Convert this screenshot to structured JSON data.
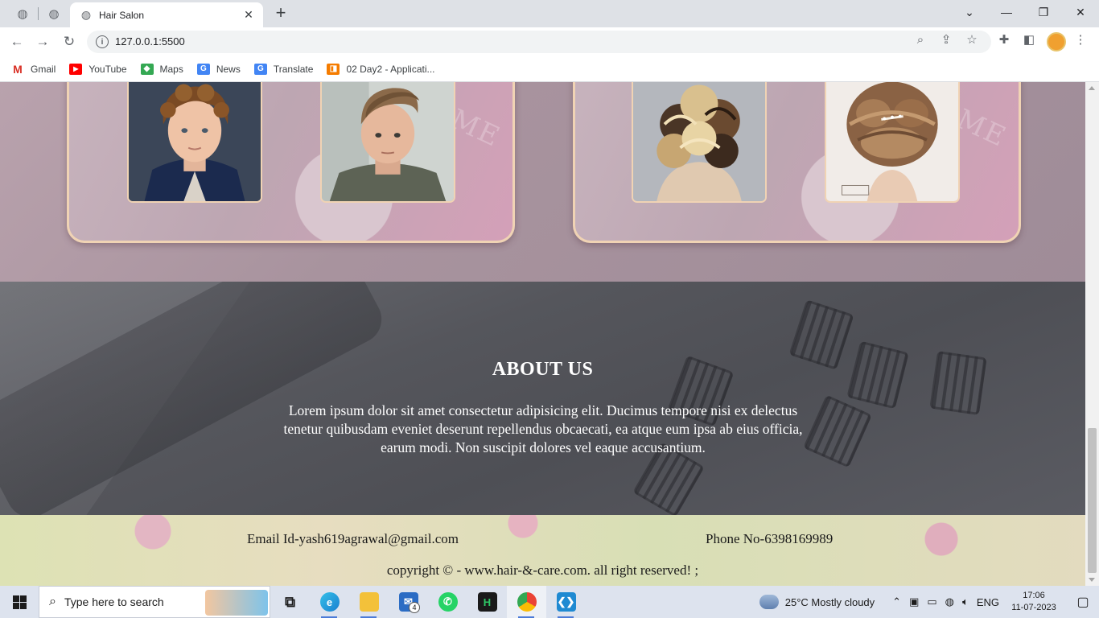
{
  "browser": {
    "tab_title": "Hair Salon",
    "url": "127.0.0.1:5500",
    "new_tab_symbol": "+",
    "tab_close_symbol": "✕",
    "bookmarks": [
      {
        "label": "Gmail",
        "icon": "gmail-icon",
        "color": "#d93025",
        "glyph": "M"
      },
      {
        "label": "YouTube",
        "icon": "youtube-icon",
        "color": "#ff0000",
        "glyph": "▶"
      },
      {
        "label": "Maps",
        "icon": "maps-icon",
        "color": "#34a853",
        "glyph": "◆"
      },
      {
        "label": "News",
        "icon": "news-icon",
        "color": "#4285f4",
        "glyph": "G"
      },
      {
        "label": "Translate",
        "icon": "translate-icon",
        "color": "#4285f4",
        "glyph": "G"
      },
      {
        "label": "02 Day2 - Applicati...",
        "icon": "app-icon",
        "color": "#f57c00",
        "glyph": "◨"
      }
    ]
  },
  "page": {
    "about": {
      "heading": "ABOUT US",
      "body": "Lorem ipsum dolor sit amet consectetur adipisicing elit. Ducimus tempore nisi ex delectus tenetur quibusdam eveniet deserunt repellendus obcaecati, ea atque eum ipsa ab eius officia, earum modi. Non suscipit dolores vel eaque accusantium."
    },
    "footer": {
      "email": "Email Id-yash619agrawal@gmail.com",
      "phone": "Phone No-6398169989",
      "copyright": "copyright © - www.hair-&-care.com. all right reserved! ;"
    },
    "gallery": {
      "image_alts": [
        "boy-curly-hair-photo",
        "boy-fade-haircut-photo",
        "curly-updo-photo",
        "braided-updo-photo"
      ]
    }
  },
  "taskbar": {
    "search_placeholder": "Type here to search",
    "weather": "25°C  Mostly cloudy",
    "language": "ENG",
    "time": "17:06",
    "date": "11-07-2023",
    "mail_badge": "4"
  },
  "colors": {
    "accent_border": "#f0d3b4",
    "about_text": "#ffffff",
    "taskbar_active_underline": "#4c7bd8"
  }
}
